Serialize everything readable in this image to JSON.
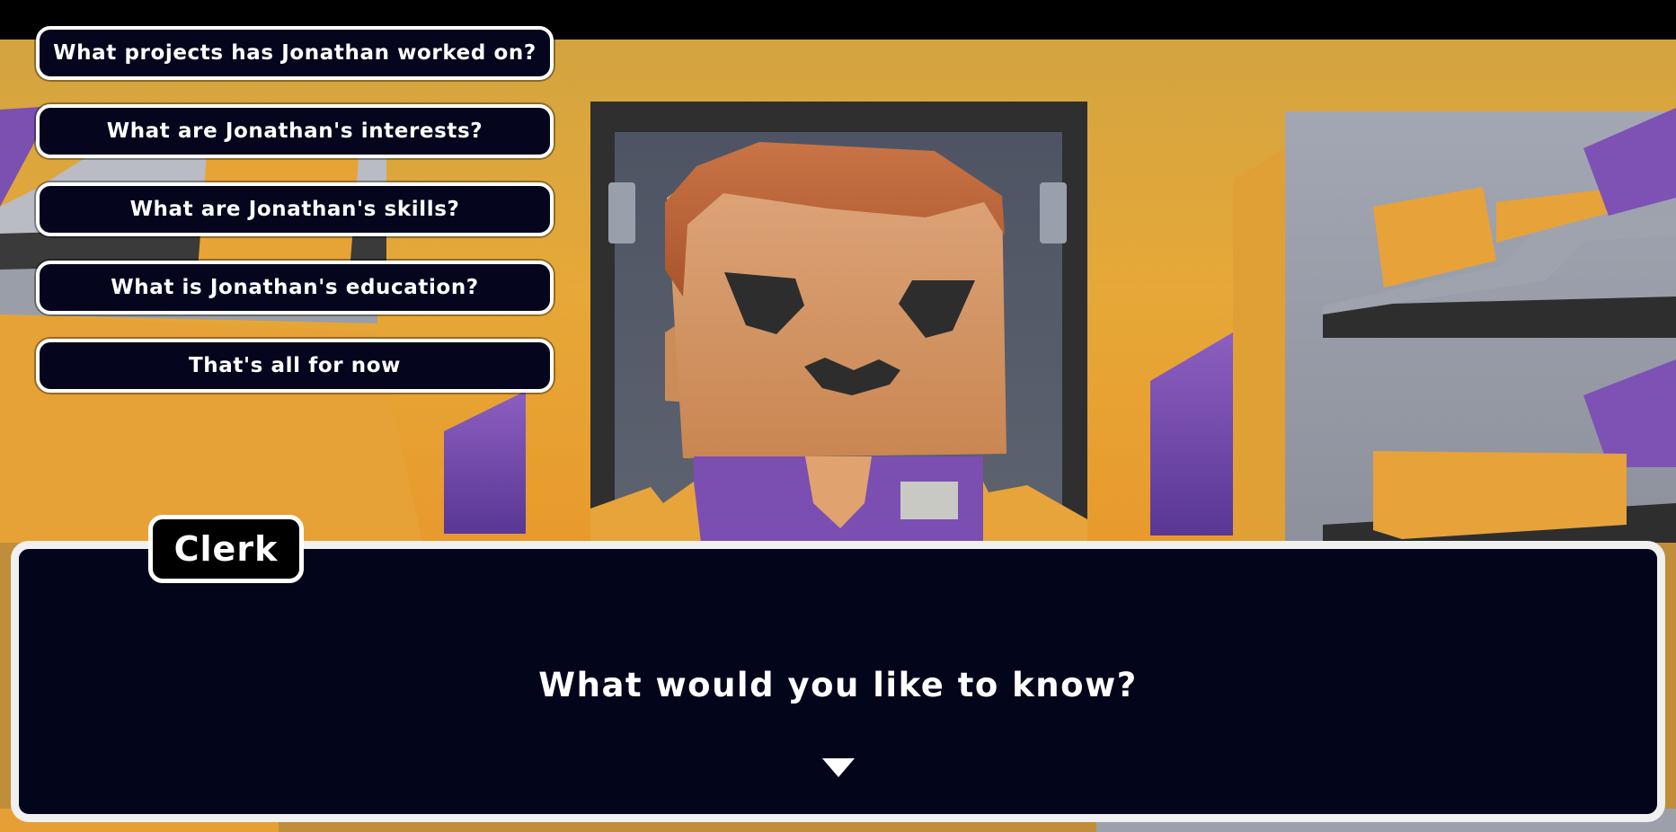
{
  "choices": [
    {
      "label": "What projects has Jonathan worked on?"
    },
    {
      "label": "What are Jonathan's interests?"
    },
    {
      "label": "What are Jonathan's skills?"
    },
    {
      "label": "What is Jonathan's education?"
    },
    {
      "label": "That's all for now"
    }
  ],
  "dialog": {
    "speaker": "Clerk",
    "text": "What would you like to know?"
  },
  "colors": {
    "panel": "#03051b",
    "border": "#ffffff",
    "wall": "#e2a437",
    "uniform_purple": "#7a4fb0",
    "skin": "#d2925e",
    "hair": "#c8693a"
  },
  "icons": {
    "advance": "triangle-down-icon"
  }
}
